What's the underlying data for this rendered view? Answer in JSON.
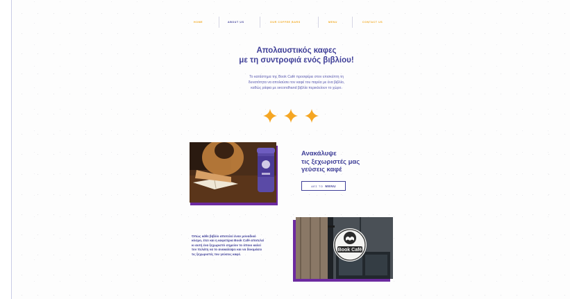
{
  "nav": {
    "items": [
      {
        "label": "HOME",
        "active": false
      },
      {
        "label": "ABOUT US",
        "active": true
      },
      {
        "label": "OUR COFFEE BARS",
        "active": false
      },
      {
        "label": "MENU",
        "active": false
      },
      {
        "label": "CONTACT US",
        "active": false
      }
    ]
  },
  "hero": {
    "title_line1": "Απολαυστικός καφες",
    "title_line2": "με τη συντροφιά ενός βιβλίου!",
    "text_line1": "Το κατάστημα της Book Café προσφέρει στον επισκέπτη τη",
    "text_line2": "δυνατότητα να απολαύσει τον καφέ του παρέα με ένα βιβλίο,",
    "text_line3": "καθώς ράφια με secondhand βιβλία περικλείουν το χώρο.",
    "star_color": "#f5a623"
  },
  "feature1": {
    "heading_line1": "Ανακάλυψε",
    "heading_line2": "τις ξεχωριστές μας",
    "heading_line3": "γεύσεις καφέ",
    "button_prefix": "ΔΕΣ ΤΟ",
    "button_label": "MENU"
  },
  "feature2": {
    "text_line1": "Όπως κάθε βιβλίο αποτελεί έναν μοναδικό",
    "text_line2": "κόσμο, έτσι και η καφετέρια Book Café αποτελεί",
    "text_line3": "κι αυτή ένα ξεχωριστό σημείον το όποιο καλεί",
    "text_line4": "τον πελάτη να το ανακαλύψει και να δοκιμάσει",
    "text_line5": "τις ξεχωριστές του γεύσεις καφέ.",
    "sign_text": "Book Café"
  },
  "colors": {
    "primary": "#3f3f98",
    "accent": "#f2a81d",
    "purple_frame": "#6c2aa0"
  }
}
